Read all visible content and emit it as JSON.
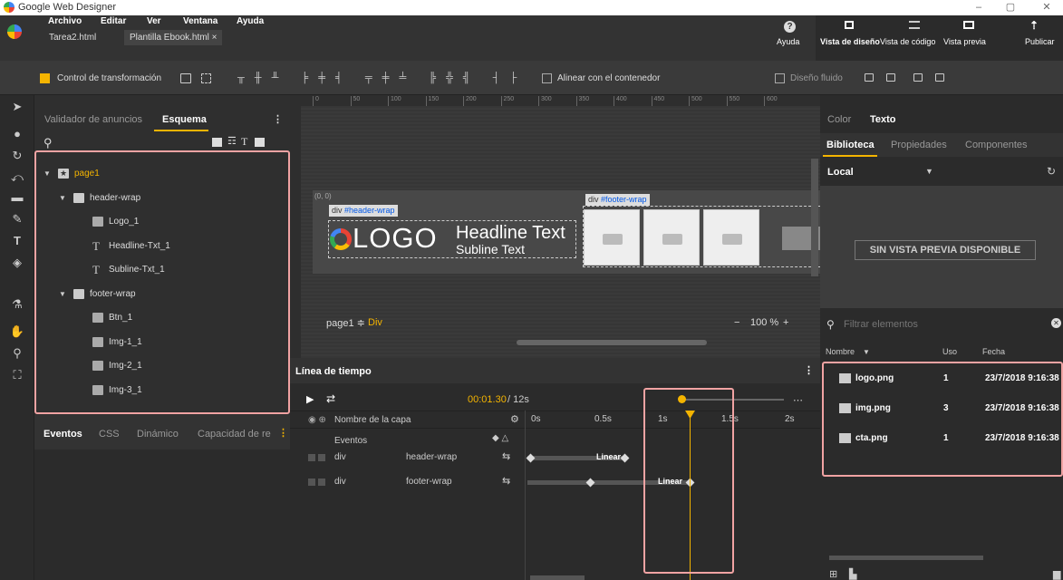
{
  "titlebar": {
    "title": "Google Web Designer",
    "min": "–",
    "max": "▢",
    "close": "✕"
  },
  "menu": {
    "items": [
      "Archivo",
      "Editar",
      "Ver",
      "Ventana",
      "Ayuda"
    ]
  },
  "doc_tabs": [
    "Tarea2.html",
    "Plantilla Ebook.html",
    "×"
  ],
  "top_right": {
    "help": "Ayuda",
    "design_view": "Vista de diseño",
    "code_view": "Vista de código",
    "preview": "Vista previa",
    "publish": "Publicar"
  },
  "toolbar": {
    "transform_control": "Control de transformación",
    "align_container": "Alinear con el contenedor",
    "fluid_design": "Diseño fluido"
  },
  "left_panel": {
    "tabs": [
      "Validador de anuncios",
      "Esquema"
    ],
    "tree": [
      {
        "label": "page1",
        "level": 0,
        "icon": "star-icon"
      },
      {
        "label": "header-wrap",
        "level": 1,
        "icon": "grid-icon"
      },
      {
        "label": "Logo_1",
        "level": 2,
        "icon": "image-icon"
      },
      {
        "label": "Headline-Txt_1",
        "level": 2,
        "icon": "text-icon"
      },
      {
        "label": "Subline-Txt_1",
        "level": 2,
        "icon": "text-icon"
      },
      {
        "label": "footer-wrap",
        "level": 1,
        "icon": "grid-icon"
      },
      {
        "label": "Btn_1",
        "level": 2,
        "icon": "image-icon"
      },
      {
        "label": "Img-1_1",
        "level": 2,
        "icon": "image-icon"
      },
      {
        "label": "Img-2_1",
        "level": 2,
        "icon": "image-icon"
      },
      {
        "label": "Img-3_1",
        "level": 2,
        "icon": "image-icon"
      }
    ],
    "bottom_tabs": [
      "Eventos",
      "CSS",
      "Dinámico",
      "Capacidad de re"
    ]
  },
  "ruler": {
    "ticks": [
      "0",
      "50",
      "100",
      "150",
      "200",
      "250",
      "300",
      "350",
      "400",
      "450",
      "500",
      "550",
      "600"
    ]
  },
  "canvas": {
    "origin": "(0, 0)",
    "header_badge_prefix": "div",
    "header_badge_id": "#header-wrap",
    "footer_badge_prefix": "div",
    "footer_badge_id": "#footer-wrap",
    "logo": "LOGO",
    "headline": "Headline Text",
    "subline": "Subline Text",
    "page_selector": "page1 ≑",
    "element": "Div",
    "zoom": "100 %",
    "zoom_minus": "−",
    "zoom_plus": "+"
  },
  "timeline": {
    "title": "Línea de tiempo",
    "time": "00:01.30",
    "duration": "/ 12s",
    "layer_header": "Nombre de la capa",
    "events": "Eventos",
    "layers": [
      {
        "type": "div",
        "name": "header-wrap",
        "ease": "Linear"
      },
      {
        "type": "div",
        "name": "footer-wrap",
        "ease": "Linear"
      }
    ],
    "ticks": [
      "0s",
      "0.5s",
      "1s",
      "1.5s",
      "2s"
    ]
  },
  "right_panel": {
    "top_tabs": [
      "Color",
      "Texto"
    ],
    "sub_tabs": [
      "Biblioteca",
      "Propiedades",
      "Componentes"
    ],
    "location": "Local",
    "no_preview": "SIN VISTA PREVIA DISPONIBLE",
    "filter_placeholder": "Filtrar elementos",
    "columns": [
      "Nombre",
      "Uso",
      "Fecha"
    ],
    "assets": [
      {
        "name": "logo.png",
        "use": "1",
        "date": "23/7/2018 9:16:38"
      },
      {
        "name": "img.png",
        "use": "3",
        "date": "23/7/2018 9:16:38"
      },
      {
        "name": "cta.png",
        "use": "1",
        "date": "23/7/2018 9:16:38"
      }
    ]
  },
  "colors": {
    "accent": "#f4b400",
    "highlight_box": "#f1a3a3"
  }
}
